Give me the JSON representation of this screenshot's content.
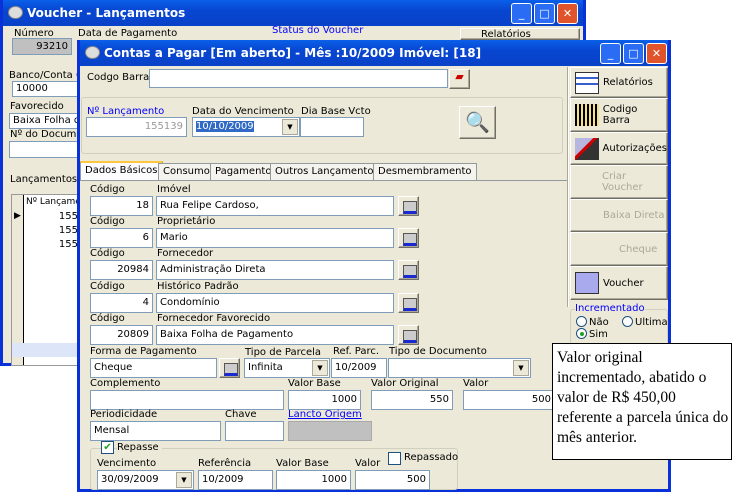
{
  "bg_window": {
    "title": "Voucher - Lançamentos",
    "numero_label": "Número",
    "numero_value": "93210",
    "data_pagamento_label": "Data de Pagamento",
    "status_label": "Status do Voucher",
    "relatorios_label": "Relatórios",
    "banco_label": "Banco/Conta C",
    "banco_value": "10000",
    "favorecido_label": "Favorecido",
    "favorecido_value": "Baixa Folha de",
    "documento_label": "Nº do Documen",
    "tab_label": "Lançamentos N",
    "grid_header": "Nº Lançame",
    "grid_rows": [
      "155",
      "155",
      "155"
    ]
  },
  "fg_window": {
    "title": "Contas a Pagar [Em aberto] - Mês :10/2009 Imóvel: [18]",
    "codigo_barra_label": "Codgo Barra",
    "codigo_barra_value": "",
    "lancamento_label": "Nº Lançamento",
    "lancamento_value": "155139",
    "vencimento_label": "Data do Vencimento",
    "vencimento_value": "10/10/2009",
    "dia_base_label": "Dia Base Vcto",
    "dia_base_value": "",
    "tabs": [
      "Dados Básicos",
      "Consumo",
      "Pagamento",
      "Outros Lançamentos",
      "Desmembramento"
    ],
    "rows": [
      {
        "code_label": "Código",
        "code": "18",
        "name_label": "Imóvel",
        "name": "Rua Felipe Cardoso,"
      },
      {
        "code_label": "Código",
        "code": "6",
        "name_label": "Proprietário",
        "name": "Mario"
      },
      {
        "code_label": "Código",
        "code": "20984",
        "name_label": "Fornecedor",
        "name": "Administração Direta"
      },
      {
        "code_label": "Código",
        "code": "4",
        "name_label": "Histórico Padrão",
        "name": "Condomínio"
      },
      {
        "code_label": "Código",
        "code": "20809",
        "name_label": "Fornecedor Favorecido",
        "name": "Baixa Folha de Pagamento"
      }
    ],
    "forma_pagamento_label": "Forma de Pagamento",
    "forma_pagamento_value": "Cheque",
    "tipo_parcela_label": "Tipo de Parcela",
    "tipo_parcela_value": "Infinita",
    "ref_parc_label": "Ref. Parc.",
    "ref_parc_value": "10/2009",
    "tipo_documento_label": "Tipo de Documento",
    "tipo_documento_value": "",
    "complemento_label": "Complemento",
    "complemento_value": "",
    "valor_base_label": "Valor Base",
    "valor_base_value": "1000",
    "valor_original_label": "Valor Original",
    "valor_original_value": "550",
    "valor_label": "Valor",
    "valor_value": "500",
    "periodicidade_label": "Periodicidade",
    "periodicidade_value": "Mensal",
    "chave_label": "Chave",
    "chave_value": "",
    "lancto_origem_label": "Lancto Origem",
    "repasse": {
      "label": "Repasse",
      "checked": true,
      "vencimento_label": "Vencimento",
      "vencimento_value": "30/09/2009",
      "referencia_label": "Referência",
      "referencia_value": "10/2009",
      "valor_base_label": "Valor Base",
      "valor_base_value": "1000",
      "valor_label": "Valor",
      "valor_value": "500",
      "repassado_label": "Repassado",
      "repassado_checked": false
    },
    "side_buttons": {
      "relatorios": "Relatórios",
      "codigo_barra": "Codigo Barra",
      "autorizacoes": "Autorizações",
      "criar_voucher": "Criar Voucher",
      "baixa_direta": "Baixa Direta",
      "cheque": "Cheque",
      "voucher": "Voucher"
    },
    "incrementado": {
      "label": "Incrementado",
      "options": [
        "Não",
        "Ultima",
        "Sim"
      ],
      "selected": "Sim"
    }
  },
  "annotation": "Valor original incrementado, abatido o valor de R$ 450,00 referente a parcela única do mês anterior."
}
